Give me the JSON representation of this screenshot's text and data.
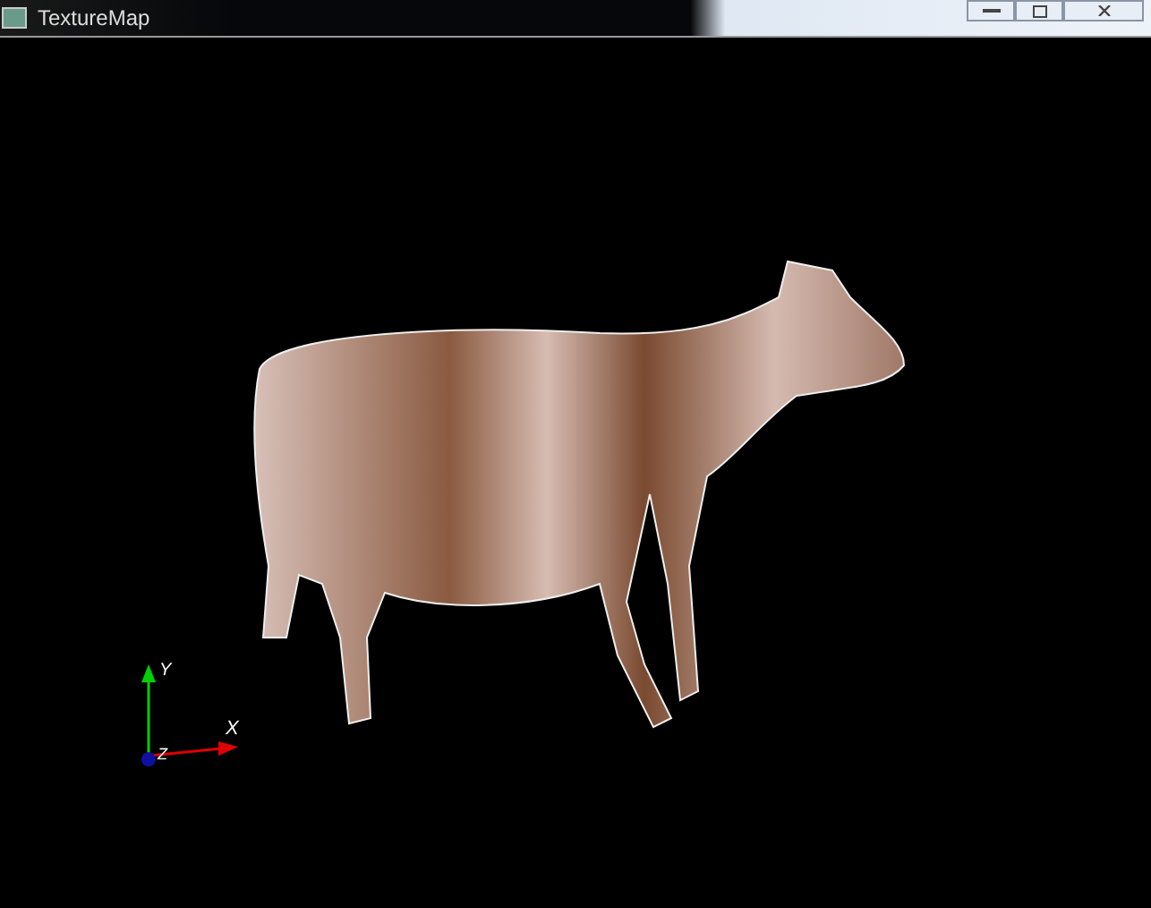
{
  "window": {
    "title": "TextureMap"
  },
  "axes": [
    {
      "label": "Y"
    },
    {
      "label": "X"
    },
    {
      "label": "Z"
    }
  ]
}
